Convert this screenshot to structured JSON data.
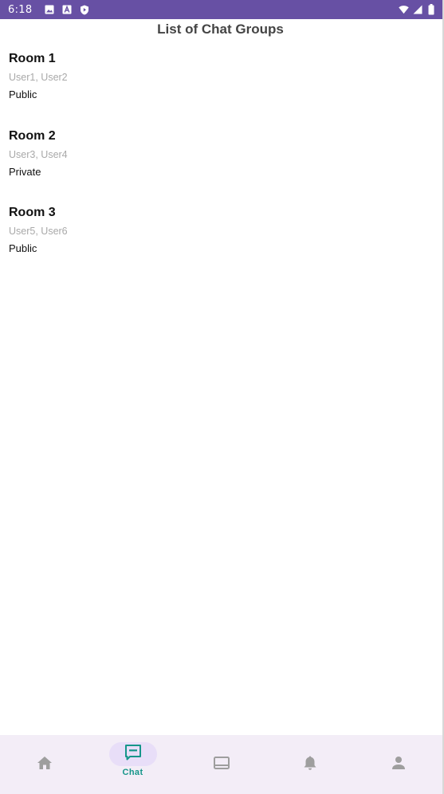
{
  "status_bar": {
    "time": "6:18",
    "left_icons": [
      "image-icon",
      "font-a-icon",
      "play-shield-icon"
    ],
    "right_icons": [
      "wifi-icon",
      "signal-icon",
      "battery-icon"
    ],
    "background": "#6750a4"
  },
  "header": {
    "title": "List of Chat Groups"
  },
  "rooms": [
    {
      "name": "Room 1",
      "users": "User1, User2",
      "type": "Public"
    },
    {
      "name": "Room 2",
      "users": "User3, User4",
      "type": "Private"
    },
    {
      "name": "Room 3",
      "users": "User5, User6",
      "type": "Public"
    }
  ],
  "bottom_nav": {
    "items": [
      {
        "icon": "home-icon",
        "label": "",
        "active": false
      },
      {
        "icon": "chat-icon",
        "label": "Chat",
        "active": true
      },
      {
        "icon": "feed-icon",
        "label": "",
        "active": false
      },
      {
        "icon": "bell-icon",
        "label": "",
        "active": false
      },
      {
        "icon": "person-icon",
        "label": "",
        "active": false
      }
    ],
    "active_color": "#16968a",
    "inactive_color": "#9e9e9e",
    "background": "#f3edf7"
  }
}
